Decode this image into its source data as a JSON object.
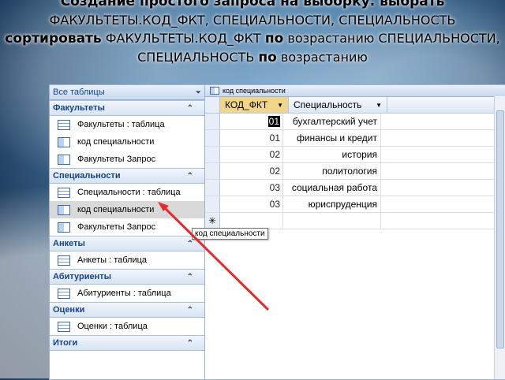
{
  "slide": {
    "title_bold1": "Создание простого запроса на выборку. выбрать",
    "title_plain1": " ФАКУЛЬТЕТЫ.КОД_ФКТ, СПЕЦИАЛЬНОСТИ, СПЕЦИАЛЬНОСТЬ ",
    "title_bold2": "сортировать",
    "title_plain2": " ФАКУЛЬТЕТЫ.КОД_ФКТ ",
    "title_bold3": "по",
    "title_plain3": " возрастанию СПЕЦИАЛЬНОСТИ, СПЕЦИАЛЬНОСТЬ ",
    "title_bold4": "по",
    "title_plain4": " возрастанию"
  },
  "nav": {
    "header": "Все таблицы",
    "dropdown_icon": "chevron-down-icon",
    "groups": [
      {
        "name": "Факультеты",
        "items": [
          {
            "label": "Факультеты : таблица",
            "icon": "table"
          },
          {
            "label": "код специальности",
            "icon": "query"
          },
          {
            "label": "Факультеты Запрос",
            "icon": "query"
          }
        ]
      },
      {
        "name": "Специальности",
        "items": [
          {
            "label": "Специальности : таблица",
            "icon": "table"
          },
          {
            "label": "код специальности",
            "icon": "query",
            "selected": true
          },
          {
            "label": "Факультеты Запрос",
            "icon": "query"
          }
        ]
      },
      {
        "name": "Анкеты",
        "items": [
          {
            "label": "Анкеты : таблица",
            "icon": "table"
          }
        ]
      },
      {
        "name": "Абитуриенты",
        "items": [
          {
            "label": "Абитуриенты : таблица",
            "icon": "table"
          }
        ]
      },
      {
        "name": "Оценки",
        "items": [
          {
            "label": "Оценки : таблица",
            "icon": "table"
          }
        ]
      },
      {
        "name": "Итоги",
        "items": []
      }
    ]
  },
  "datasheet": {
    "tab_title": "код специальности",
    "columns": [
      "КОД_ФКТ",
      "Специальность"
    ],
    "rows": [
      {
        "kod": "01",
        "spec": "бухгалтерский учет"
      },
      {
        "kod": "01",
        "spec": "финансы и кредит"
      },
      {
        "kod": "02",
        "spec": "история"
      },
      {
        "kod": "02",
        "spec": "политология"
      },
      {
        "kod": "03",
        "spec": "социальная работа"
      },
      {
        "kod": "03",
        "spec": "юриспруденция"
      }
    ],
    "new_row_marker": "✳"
  },
  "tooltip": "код специальности",
  "colors": {
    "arrow": "#e8282a",
    "accent": "#15428b"
  }
}
